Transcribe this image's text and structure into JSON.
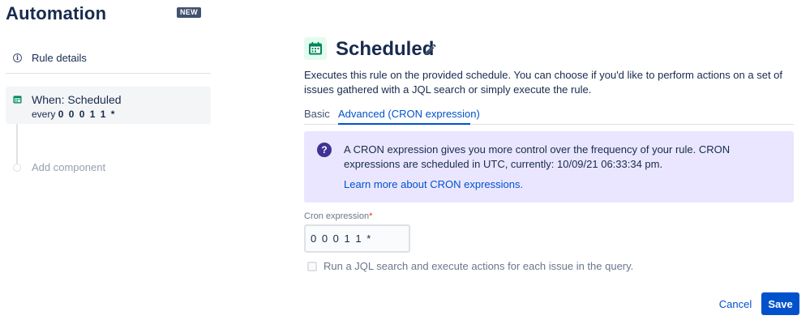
{
  "app": {
    "title": "Automation",
    "badge": "NEW"
  },
  "sidebar": {
    "rule_details_label": "Rule details",
    "trigger": {
      "title": "When: Scheduled",
      "prefix": "every ",
      "cron": "0 0 0 1 1 *"
    },
    "add_component_label": "Add component"
  },
  "main": {
    "title": "Scheduled",
    "description": "Executes this rule on the provided schedule. You can choose if you'd like to perform actions on a set of issues gathered with a JQL search or simply execute the rule.",
    "tabs": [
      {
        "label": "Basic",
        "active": false
      },
      {
        "label": "Advanced (CRON expression)",
        "active": true
      }
    ],
    "info": {
      "text": "A CRON expression gives you more control over the frequency of your rule. CRON expressions are scheduled in UTC, currently: 10/09/21 06:33:34 pm.",
      "link": "Learn more about CRON expressions."
    },
    "cron_field": {
      "label": "Cron expression",
      "required_marker": "*",
      "value": "0 0 0 1 1 *"
    },
    "jql_checkbox": {
      "label": "Run a JQL search and execute actions for each issue in the query.",
      "checked": false
    },
    "buttons": {
      "cancel": "Cancel",
      "save": "Save"
    }
  },
  "colors": {
    "primary": "#0052cc",
    "info_bg": "#eae6ff",
    "info_icon": "#403294",
    "calendar_green": "#00875a",
    "badge_bg": "#42526e",
    "required": "#de350b"
  },
  "icons": {
    "rule_details": "info-icon",
    "trigger": "calendar-icon",
    "title": "calendar-icon",
    "edit": "pencil-icon",
    "info": "question-icon"
  }
}
